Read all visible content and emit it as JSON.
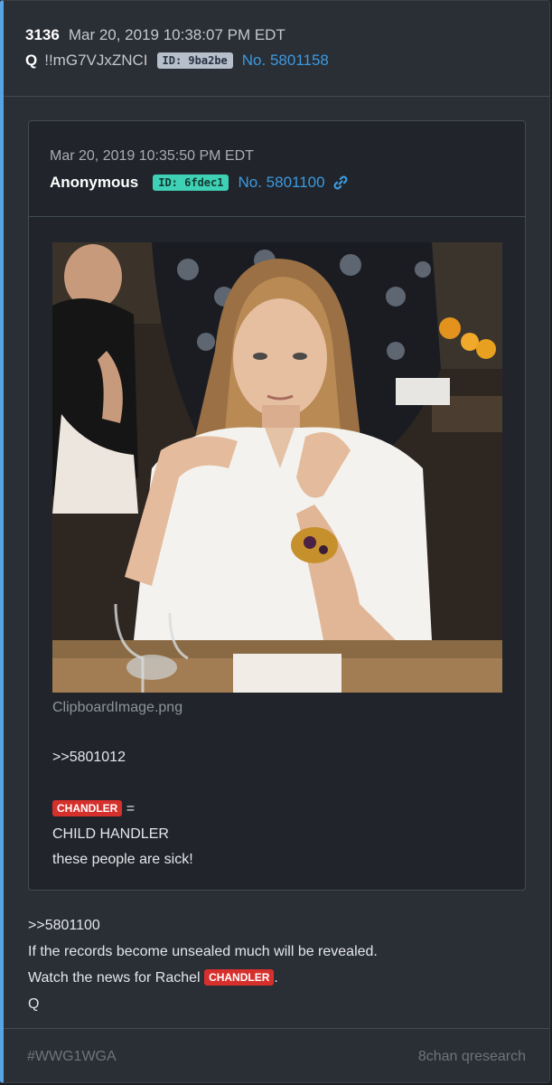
{
  "post": {
    "number": "3136",
    "date": "Mar 20, 2019 10:38:07 PM EDT",
    "name": "Q",
    "tripcode": "!!mG7VJxZNCI",
    "id_badge": "ID: 9ba2be",
    "post_no": "No. 5801158",
    "body": {
      "line1": ">>5801100",
      "line2": "If the records become unsealed much will be revealed.",
      "line3_prefix": "Watch the news for Rachel",
      "line3_tag": "CHANDLER",
      "line3_suffix": ".",
      "line4": "Q"
    }
  },
  "quoted": {
    "date": "Mar 20, 2019 10:35:50 PM EDT",
    "name": "Anonymous",
    "id_badge": "ID: 6fdec1",
    "post_no": "No. 5801100",
    "filename": "ClipboardImage.png",
    "body": {
      "line1": ">>5801012",
      "tag": "CHANDLER",
      "after_tag": " =",
      "line3": "CHILD HANDLER",
      "line4": "these people are sick!"
    }
  },
  "footer": {
    "hashtag": "#WWG1WGA",
    "source": "8chan qresearch"
  },
  "colors": {
    "accent_bar": "#5aa2e6",
    "link": "#3c9ae0",
    "tag": "#d6302c",
    "id_badge_q": "#b7bfca",
    "id_badge_anon": "#3ed1b5"
  }
}
